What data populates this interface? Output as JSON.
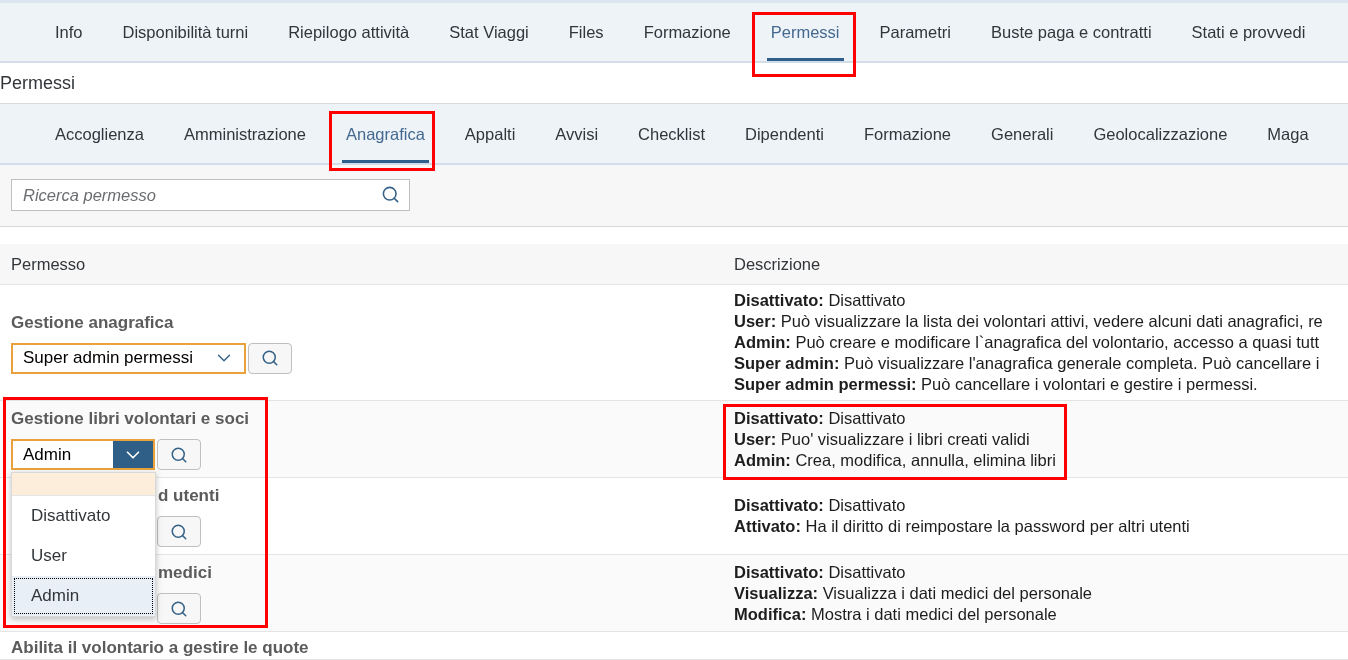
{
  "top_tabs": [
    {
      "label": "Info",
      "selected": false,
      "highlighted": false
    },
    {
      "label": "Disponibilità turni",
      "selected": false,
      "highlighted": false
    },
    {
      "label": "Riepilogo attività",
      "selected": false,
      "highlighted": false
    },
    {
      "label": "Stat Viaggi",
      "selected": false,
      "highlighted": false
    },
    {
      "label": "Files",
      "selected": false,
      "highlighted": false
    },
    {
      "label": "Formazione",
      "selected": false,
      "highlighted": false
    },
    {
      "label": "Permessi",
      "selected": true,
      "highlighted": true
    },
    {
      "label": "Parametri",
      "selected": false,
      "highlighted": false
    },
    {
      "label": "Buste paga e contratti",
      "selected": false,
      "highlighted": false
    },
    {
      "label": "Stati e provvedi",
      "selected": false,
      "highlighted": false
    }
  ],
  "page_title": "Permessi",
  "sub_tabs": [
    {
      "label": "Accoglienza",
      "selected": false,
      "highlighted": false
    },
    {
      "label": "Amministrazione",
      "selected": false,
      "highlighted": false
    },
    {
      "label": "Anagrafica",
      "selected": true,
      "highlighted": true
    },
    {
      "label": "Appalti",
      "selected": false,
      "highlighted": false
    },
    {
      "label": "Avvisi",
      "selected": false,
      "highlighted": false
    },
    {
      "label": "Checklist",
      "selected": false,
      "highlighted": false
    },
    {
      "label": "Dipendenti",
      "selected": false,
      "highlighted": false
    },
    {
      "label": "Formazione",
      "selected": false,
      "highlighted": false
    },
    {
      "label": "Generali",
      "selected": false,
      "highlighted": false
    },
    {
      "label": "Geolocalizzazione",
      "selected": false,
      "highlighted": false
    },
    {
      "label": "Maga",
      "selected": false,
      "highlighted": false
    }
  ],
  "search": {
    "placeholder": "Ricerca permesso"
  },
  "table": {
    "columns": [
      "Permesso",
      "Descrizione"
    ],
    "rows": [
      {
        "title": "Gestione anagrafica",
        "highlight_permission": false,
        "highlight_description": false,
        "select": {
          "value": "Super admin permessi",
          "open": false
        },
        "description": [
          "**Disattivato:** Disattivato",
          "**User:** Può visualizzare la lista dei volontari attivi, vedere alcuni dati anagrafici, re",
          "**Admin:** Può creare e modificare l`anagrafica del volontario, accesso a quasi tutt",
          "**Super admin:** Può visualizzare l'anagrafica generale completa. Può cancellare i",
          "**Super admin permessi:** Può cancellare i volontari e gestire i permessi."
        ]
      },
      {
        "title": "Gestione libri volontari e soci",
        "highlight_permission": true,
        "highlight_description": true,
        "select": {
          "value": "Admin",
          "open": true,
          "options": [
            {
              "kind": "blank"
            },
            {
              "kind": "option",
              "label": "Disattivato",
              "selected": false
            },
            {
              "kind": "option",
              "label": "User",
              "selected": false
            },
            {
              "kind": "option",
              "label": "Admin",
              "selected": true
            }
          ]
        },
        "description": [
          "**Disattivato:** Disattivato",
          "**User:** Puo' visualizzare i libri creati validi",
          "**Admin:** Crea, modifica, annulla, elimina libri"
        ]
      },
      {
        "title": "d utenti",
        "highlight_permission": false,
        "highlight_description": false,
        "description": [
          "**Disattivato:** Disattivato",
          "**Attivato:** Ha il diritto di reimpostare la password per altri utenti"
        ]
      },
      {
        "title": "medici",
        "highlight_permission": false,
        "highlight_description": false,
        "description": [
          "**Disattivato:** Disattivato",
          "**Visualizza:** Visualizza i dati medici del personale",
          "**Modifica:** Mostra i dati medici del personale"
        ]
      },
      {
        "title": "Abilita il volontario a gestire le quote",
        "highlight_permission": false,
        "highlight_description": false
      }
    ]
  }
}
